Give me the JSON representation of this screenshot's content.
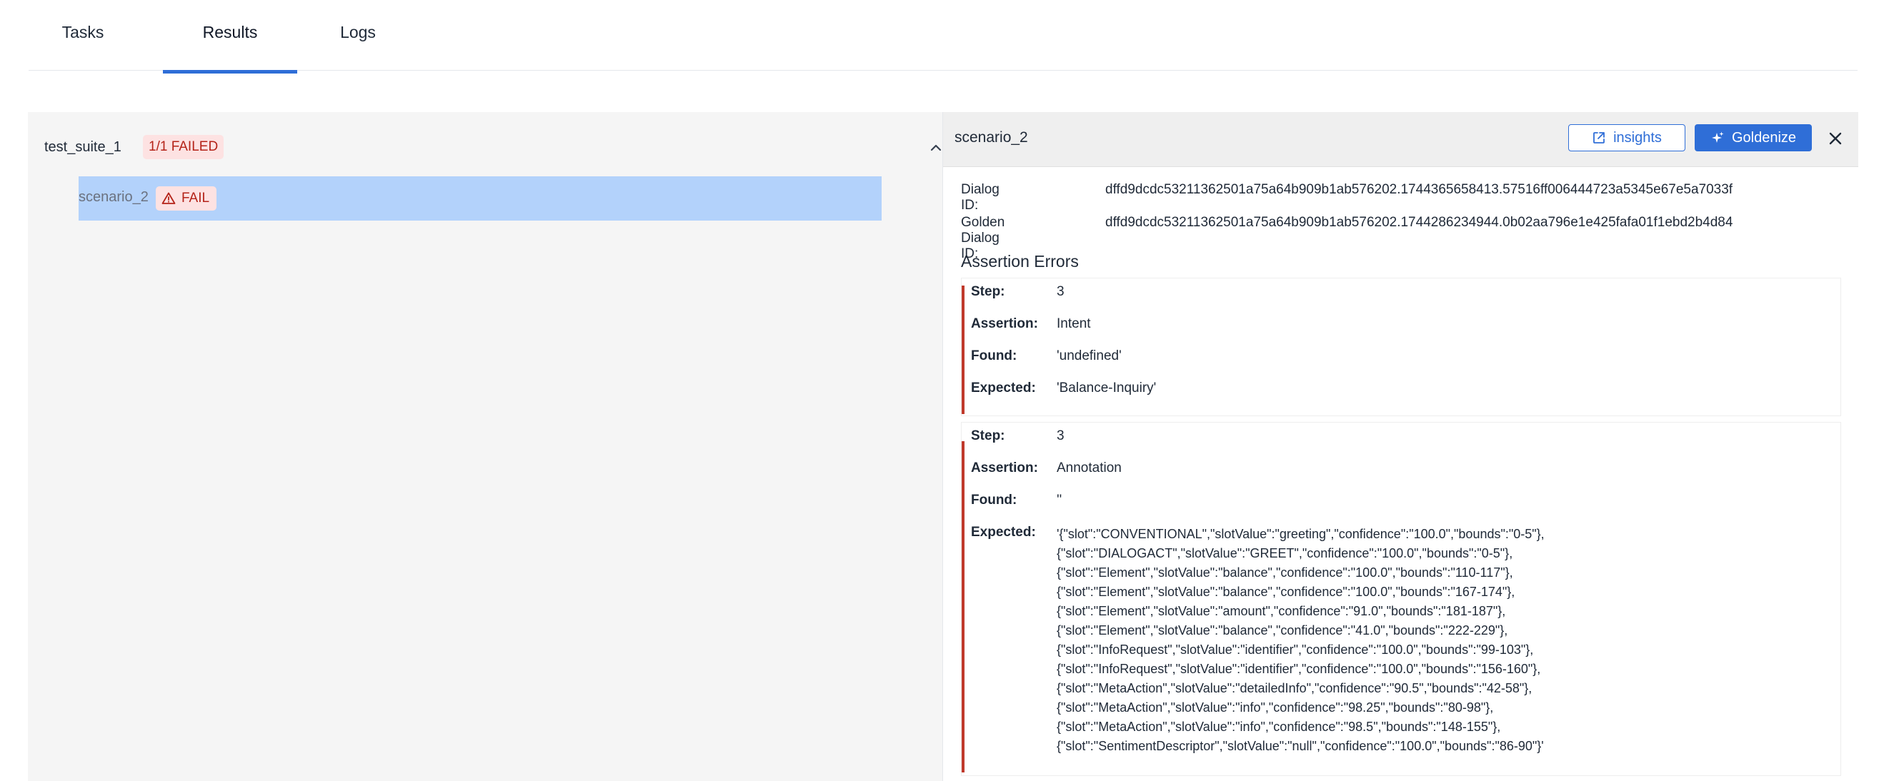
{
  "tabs": [
    {
      "label": "Tasks",
      "active": false
    },
    {
      "label": "Results",
      "active": true
    },
    {
      "label": "Logs",
      "active": false
    }
  ],
  "suite": {
    "name": "test_suite_1",
    "status_badge": "1/1 FAILED",
    "scenarios": [
      {
        "name": "scenario_2",
        "status": "FAIL",
        "selected": true
      }
    ]
  },
  "detail": {
    "title": "scenario_2",
    "insights_label": "insights",
    "goldenize_label": "Goldenize",
    "dialog_id_label": "Dialog ID:",
    "dialog_id": "dffd9dcdc53211362501a75a64b909b1ab576202.1744365658413.57516ff006444723a5345e67e5a7033f",
    "golden_dialog_id_label": "Golden Dialog ID:",
    "golden_dialog_id": "dffd9dcdc53211362501a75a64b909b1ab576202.1744286234944.0b02aa796e1e425fafa01f1ebd2b4d84",
    "assertion_errors_title": "Assertion Errors",
    "labels": {
      "step": "Step:",
      "assertion": "Assertion:",
      "found": "Found:",
      "expected": "Expected:"
    },
    "errors": [
      {
        "step": "3",
        "assertion": "Intent",
        "found": "'undefined'",
        "expected": "'Balance-Inquiry'"
      },
      {
        "step": "3",
        "assertion": "Annotation",
        "found": "''",
        "expected_lines": [
          "'{\"slot\":\"CONVENTIONAL\",\"slotValue\":\"greeting\",\"confidence\":\"100.0\",\"bounds\":\"0-5\"},",
          "{\"slot\":\"DIALOGACT\",\"slotValue\":\"GREET\",\"confidence\":\"100.0\",\"bounds\":\"0-5\"},",
          "{\"slot\":\"Element\",\"slotValue\":\"balance\",\"confidence\":\"100.0\",\"bounds\":\"110-117\"},",
          "{\"slot\":\"Element\",\"slotValue\":\"balance\",\"confidence\":\"100.0\",\"bounds\":\"167-174\"},",
          "{\"slot\":\"Element\",\"slotValue\":\"amount\",\"confidence\":\"91.0\",\"bounds\":\"181-187\"},",
          "{\"slot\":\"Element\",\"slotValue\":\"balance\",\"confidence\":\"41.0\",\"bounds\":\"222-229\"},",
          "{\"slot\":\"InfoRequest\",\"slotValue\":\"identifier\",\"confidence\":\"100.0\",\"bounds\":\"99-103\"},",
          "{\"slot\":\"InfoRequest\",\"slotValue\":\"identifier\",\"confidence\":\"100.0\",\"bounds\":\"156-160\"},",
          "{\"slot\":\"MetaAction\",\"slotValue\":\"detailedInfo\",\"confidence\":\"90.5\",\"bounds\":\"42-58\"},",
          "{\"slot\":\"MetaAction\",\"slotValue\":\"info\",\"confidence\":\"98.25\",\"bounds\":\"80-98\"},",
          "{\"slot\":\"MetaAction\",\"slotValue\":\"info\",\"confidence\":\"98.5\",\"bounds\":\"148-155\"},",
          "{\"slot\":\"SentimentDescriptor\",\"slotValue\":\"null\",\"confidence\":\"100.0\",\"bounds\":\"86-90\"}'"
        ]
      }
    ]
  },
  "colors": {
    "accent": "#2f6ed7",
    "fail_bg": "#fde2e2",
    "fail_text": "#b42318",
    "selected_row": "#b3d2fb",
    "error_bar": "#c0392b"
  },
  "icons": {
    "collapse": "chevron-up-icon",
    "fail": "warning-triangle-icon",
    "insights": "external-link-icon",
    "goldenize": "sparkle-icon",
    "close": "close-icon"
  }
}
